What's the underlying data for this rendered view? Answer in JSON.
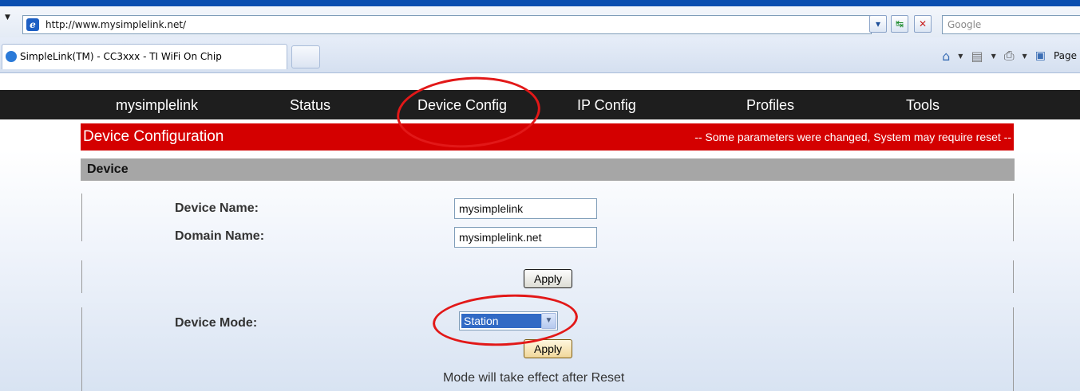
{
  "browser": {
    "url": "http://www.mysimplelink.net/",
    "search_placeholder": "Google",
    "tab_title": "SimpleLink(TM) - CC3xxx - TI WiFi On Chip",
    "page_menu_label": "Page",
    "icons": [
      "ie-logo-icon",
      "dropdown-icon",
      "refresh-icon",
      "stop-icon",
      "home-icon",
      "feeds-icon",
      "print-icon",
      "page-icon"
    ]
  },
  "nav": {
    "items": [
      "mysimplelink",
      "Status",
      "Device Config",
      "IP Config",
      "Profiles",
      "Tools"
    ]
  },
  "header": {
    "title": "Device Configuration",
    "message": "-- Some parameters were changed, System may require reset --"
  },
  "device": {
    "section_title": "Device",
    "device_name_label": "Device Name:",
    "device_name_value": "mysimplelink",
    "domain_name_label": "Domain Name:",
    "domain_name_value": "mysimplelink.net",
    "apply_label": "Apply",
    "device_mode_label": "Device Mode:",
    "device_mode_value": "Station",
    "apply_mode_label": "Apply",
    "mode_note": "Mode will take effect after Reset"
  },
  "colors": {
    "nav_bg": "#1e1e1e",
    "header_red": "#d40000",
    "section_gray": "#a6a6a6",
    "annotation_red": "#e21818",
    "selection_blue": "#316ac5"
  }
}
